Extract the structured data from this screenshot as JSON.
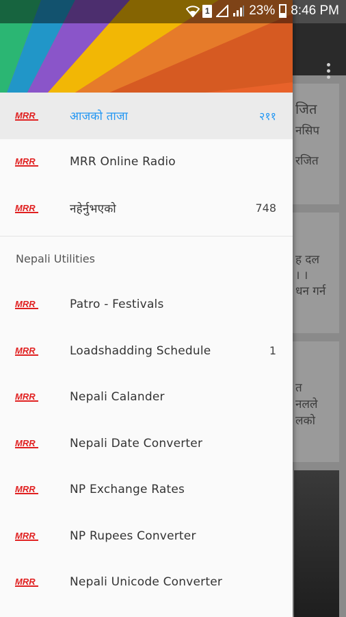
{
  "status_bar": {
    "battery": "23%",
    "time": "8:46 PM",
    "sim_slot": "1"
  },
  "background": {
    "card1_lines": [
      "जित",
      "नसिप",
      "रजित"
    ],
    "card2_lines": [
      "ह दल",
      "। ।",
      "धन गर्न"
    ],
    "card3_lines": [
      "त",
      "नलले",
      "लको"
    ]
  },
  "drawer": {
    "items_top": [
      {
        "label": "आजको ताजा",
        "count": "२११",
        "active": true
      },
      {
        "label": "MRR Online Radio",
        "count": "",
        "active": false
      },
      {
        "label": "नहेर्नुभएको",
        "count": "748",
        "active": false
      }
    ],
    "section_title": "Nepali Utilities",
    "utilities": [
      {
        "label": "Patro - Festivals",
        "count": ""
      },
      {
        "label": "Loadshadding Schedule",
        "count": "1"
      },
      {
        "label": "Nepali Calander",
        "count": ""
      },
      {
        "label": "Nepali Date Converter",
        "count": ""
      },
      {
        "label": "NP Exchange Rates",
        "count": ""
      },
      {
        "label": "NP Rupees Converter",
        "count": ""
      },
      {
        "label": "Nepali Unicode Converter",
        "count": ""
      }
    ],
    "logo_text": "MRR"
  },
  "colors": {
    "accent": "#2196f3",
    "logo_red": "#e02020"
  }
}
